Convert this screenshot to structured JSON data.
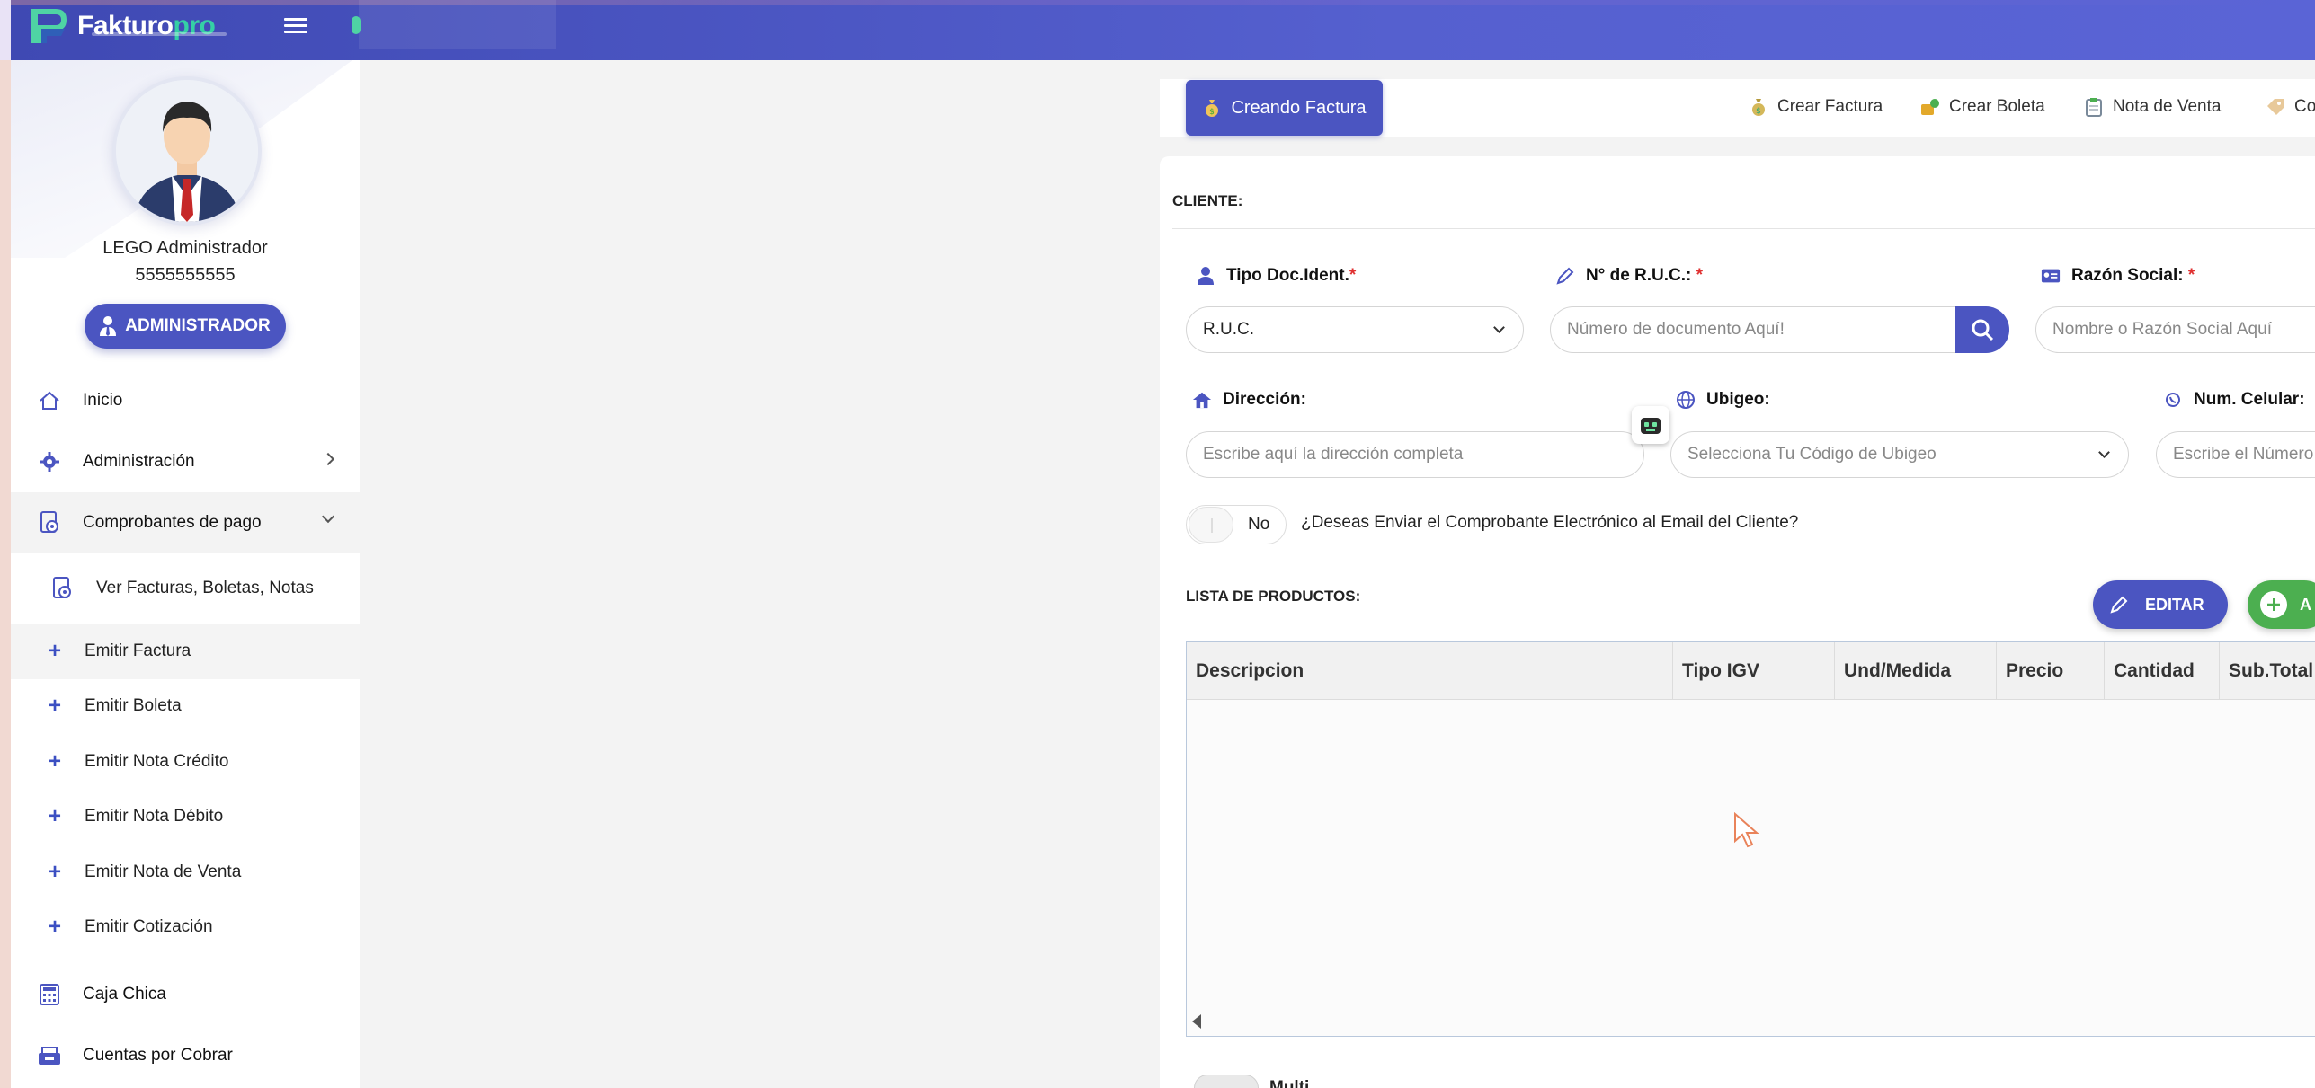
{
  "app": {
    "brand_main": "Fakturo",
    "brand_suffix": "pro"
  },
  "colors": {
    "primary": "#4b55c1",
    "topbar": "#5560cf",
    "success": "#4caf50",
    "required": "#e03131"
  },
  "user": {
    "name": "LEGO Administrador",
    "phone": "5555555555",
    "role": "ADMINISTRADOR"
  },
  "sidebar": {
    "items": [
      {
        "label": "Inicio",
        "icon": "home-icon"
      },
      {
        "label": "Administración",
        "icon": "gear-icon"
      },
      {
        "label": "Comprobantes de pago",
        "icon": "receipt-icon"
      }
    ],
    "sub_items": [
      {
        "label": "Ver Facturas, Boletas, Notas"
      },
      {
        "label": "Emitir Factura"
      },
      {
        "label": "Emitir Boleta"
      },
      {
        "label": "Emitir Nota Crédito"
      },
      {
        "label": "Emitir Nota Débito"
      },
      {
        "label": "Emitir Nota de Venta"
      },
      {
        "label": "Emitir Cotización"
      }
    ],
    "lower_items": [
      {
        "label": "Caja Chica",
        "icon": "calculator-icon"
      },
      {
        "label": "Cuentas por Cobrar",
        "icon": "cash-register-icon"
      }
    ]
  },
  "header": {
    "creating_label": "Creando Factura",
    "links": [
      {
        "label": "Crear Factura"
      },
      {
        "label": "Crear Boleta"
      },
      {
        "label": "Nota de Venta"
      },
      {
        "label": "Co"
      }
    ]
  },
  "form": {
    "client_section": "CLIENTE:",
    "doc_type_label": "Tipo Doc.Ident.",
    "doc_type_value": "R.U.C.",
    "ruc_label": "N° de R.U.C.:",
    "ruc_placeholder": "Número de documento Aquí!",
    "razon_label": "Razón Social:",
    "razon_placeholder": "Nombre o Razón Social Aquí",
    "direccion_label": "Dirección:",
    "direccion_placeholder": "Escribe aquí la dirección completa",
    "ubigeo_label": "Ubigeo:",
    "ubigeo_placeholder": "Selecciona Tu Código de Ubigeo",
    "celular_label": "Num. Celular:",
    "celular_placeholder": "Escribe el Número",
    "required_mark": "*",
    "email_toggle_value": "No",
    "email_toggle_question": "¿Deseas Enviar el Comprobante Electrónico al Email del Cliente?"
  },
  "products": {
    "section_label": "LISTA DE PRODUCTOS:",
    "edit_label": "EDITAR",
    "add_label": "A",
    "columns": [
      "Descripcion",
      "Tipo IGV",
      "Und/Medida",
      "Precio",
      "Cantidad",
      "Sub.Total"
    ],
    "rows": []
  },
  "bottom": {
    "partial_label": "Multi"
  }
}
